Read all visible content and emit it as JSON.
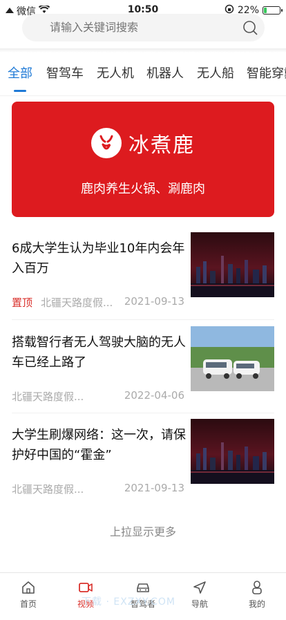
{
  "status_bar": {
    "carrier": "微信",
    "time": "10:50",
    "battery": "22%",
    "battery_level": 0.22
  },
  "search": {
    "placeholder": "请输入关键词搜索"
  },
  "tabs": [
    {
      "label": "全部",
      "active": true
    },
    {
      "label": "智驾车"
    },
    {
      "label": "无人机"
    },
    {
      "label": "机器人"
    },
    {
      "label": "无人船"
    },
    {
      "label": "智能穿戴"
    }
  ],
  "banner": {
    "brand": "冰煮鹿",
    "slogan": "鹿肉养生火锅、涮鹿肉",
    "background": "#dd1b1f"
  },
  "news": [
    {
      "title": "6成大学生认为毕业10年内会年入百万",
      "tag": "置顶",
      "source": "北疆天路度假...",
      "date": "2021-09-13",
      "thumb": "city-night-skyline"
    },
    {
      "title": "搭载智行者无人驾驶大脑的无人车已经上路了",
      "tag": "",
      "source": "北疆天路度假...",
      "date": "2022-04-06",
      "thumb": "autonomous-vehicles-road"
    },
    {
      "title": "大学生刷爆网络：这一次，请保护好中国的“霍金”",
      "tag": "",
      "source": "北疆天路度假...",
      "date": "2021-09-13",
      "thumb": "city-night-skyline"
    }
  ],
  "load_more": "上拉显示更多",
  "bottom_nav": [
    {
      "label": "首页",
      "icon": "home-icon"
    },
    {
      "label": "视频",
      "icon": "video-icon",
      "active": true
    },
    {
      "label": "智驾者",
      "icon": "car-icon"
    },
    {
      "label": "导航",
      "icon": "navigation-icon"
    },
    {
      "label": "我的",
      "icon": "user-icon"
    }
  ],
  "watermark": "下载 · EXZXY.COM",
  "colors": {
    "accent": "#1f7ad6",
    "active_nav": "#d9302b",
    "tag": "#d9302b"
  }
}
